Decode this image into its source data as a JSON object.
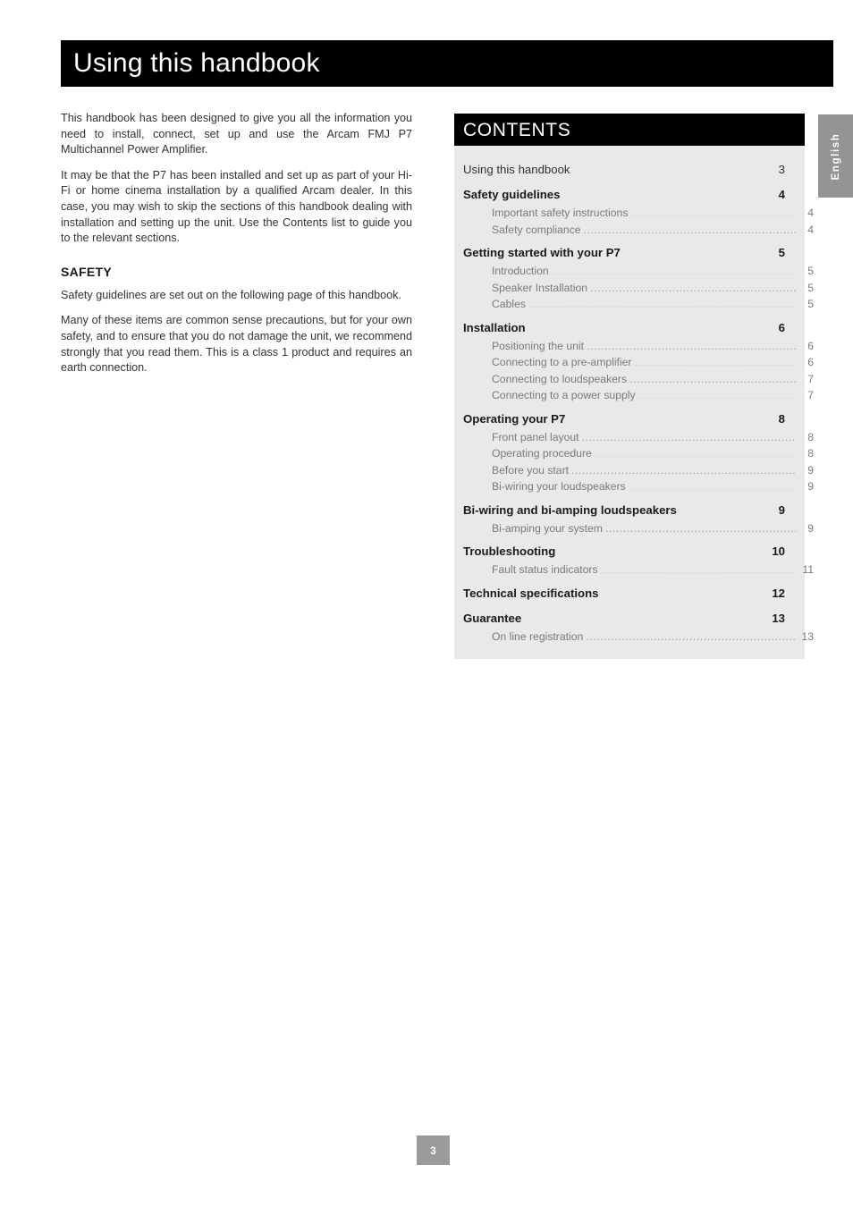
{
  "page": {
    "title": "Using this handbook",
    "language_tab": "English",
    "page_number": "3"
  },
  "intro": {
    "paragraph_1": "This handbook has been designed to give you all the information you need to install, connect, set up and use the Arcam FMJ P7 Multichannel Power Amplifier.",
    "paragraph_2": "It may be that the P7 has been installed and set up as part of your Hi-Fi or home cinema installation by a qualified Arcam dealer. In this case, you may wish to skip the sections of this handbook dealing with installation and setting up the unit. Use the Contents list to guide you to the relevant sections."
  },
  "safety": {
    "heading": "SAFETY",
    "paragraph_1": "Safety guidelines are set out on the following page of this handbook.",
    "paragraph_2": "Many of these items are common sense precautions, but for your own safety, and to ensure that you do not damage the unit, we recommend strongly that you read them. This is a class 1 product and requires an earth connection."
  },
  "contents": {
    "heading": "CONTENTS",
    "groups": [
      {
        "entry": {
          "label": "Using this handbook",
          "page": "3",
          "current": true
        },
        "children": []
      },
      {
        "entry": {
          "label": "Safety guidelines",
          "page": "4"
        },
        "children": [
          {
            "label": "Important safety instructions",
            "page": "4"
          },
          {
            "label": "Safety compliance",
            "page": "4"
          }
        ]
      },
      {
        "entry": {
          "label": "Getting started with your P7",
          "page": "5"
        },
        "children": [
          {
            "label": "Introduction",
            "page": "5"
          },
          {
            "label": "Speaker Installation",
            "page": "5"
          },
          {
            "label": "Cables",
            "page": "5"
          }
        ]
      },
      {
        "entry": {
          "label": "Installation",
          "page": "6"
        },
        "children": [
          {
            "label": "Positioning the unit",
            "page": "6"
          },
          {
            "label": "Connecting to a pre-amplifier",
            "page": "6"
          },
          {
            "label": "Connecting to loudspeakers",
            "page": "7"
          },
          {
            "label": "Connecting to a power supply",
            "page": "7"
          }
        ]
      },
      {
        "entry": {
          "label": "Operating your P7",
          "page": "8"
        },
        "children": [
          {
            "label": "Front panel layout",
            "page": "8"
          },
          {
            "label": "Operating procedure",
            "page": "8"
          },
          {
            "label": "Before you start",
            "page": "9"
          },
          {
            "label": "Bi-wiring your loudspeakers",
            "page": "9"
          }
        ]
      },
      {
        "entry": {
          "label": "Bi-wiring and bi-amping loudspeakers",
          "page": "9"
        },
        "children": [
          {
            "label": "Bi-amping your system",
            "page": "9"
          }
        ]
      },
      {
        "entry": {
          "label": "Troubleshooting",
          "page": "10"
        },
        "children": [
          {
            "label": "Fault status indicators",
            "page": "11"
          }
        ]
      },
      {
        "entry": {
          "label": "Technical specifications",
          "page": "12"
        },
        "children": []
      },
      {
        "entry": {
          "label": "Guarantee",
          "page": "13"
        },
        "children": [
          {
            "label": "On line registration",
            "page": "13"
          }
        ]
      }
    ]
  }
}
